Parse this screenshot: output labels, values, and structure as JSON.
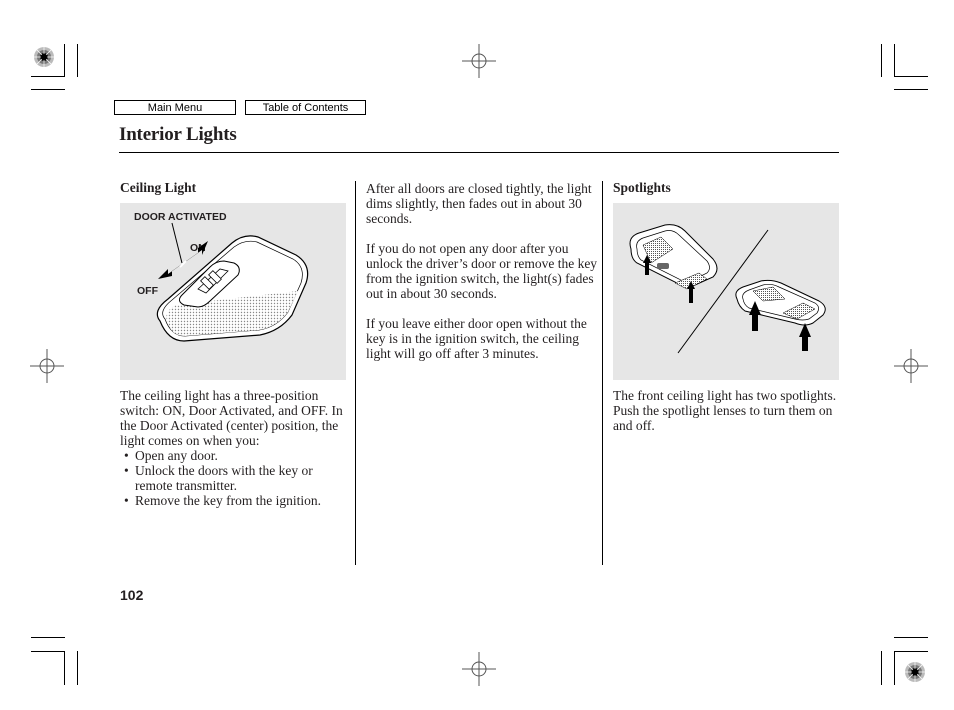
{
  "nav": {
    "main_menu": "Main Menu",
    "table_of_contents": "Table of Contents"
  },
  "page": {
    "title": "Interior Lights",
    "page_number": "102"
  },
  "ceiling_light": {
    "heading": "Ceiling Light",
    "figure": {
      "labels": {
        "door_activated": "DOOR ACTIVATED",
        "on": "ON",
        "off": "OFF"
      }
    },
    "intro": "The ceiling light has a three-position switch: ON, Door Activated, and OFF. In the Door Activated (center) position, the light comes on when you:",
    "bullets": [
      "Open any door.",
      "Unlock the doors with the key or remote transmitter.",
      "Remove the key from the ignition."
    ],
    "bullet_glyph": "•"
  },
  "middle_column": {
    "paragraphs": [
      "After all doors are closed tightly, the light dims slightly, then fades out in about 30 seconds.",
      "If you do not open any door after you unlock the driver’s door or remove the key from the ignition switch, the light(s) fades out in about 30 seconds.",
      "If you leave either door open without the key is in the ignition switch, the ceiling light will go off after 3 minutes."
    ]
  },
  "spotlights": {
    "heading": "Spotlights",
    "text": "The front ceiling light has two spotlights. Push the spotlight lenses to turn them on and off."
  },
  "colors": {
    "figure_background": "#e6e6e6",
    "text": "#231f20"
  }
}
